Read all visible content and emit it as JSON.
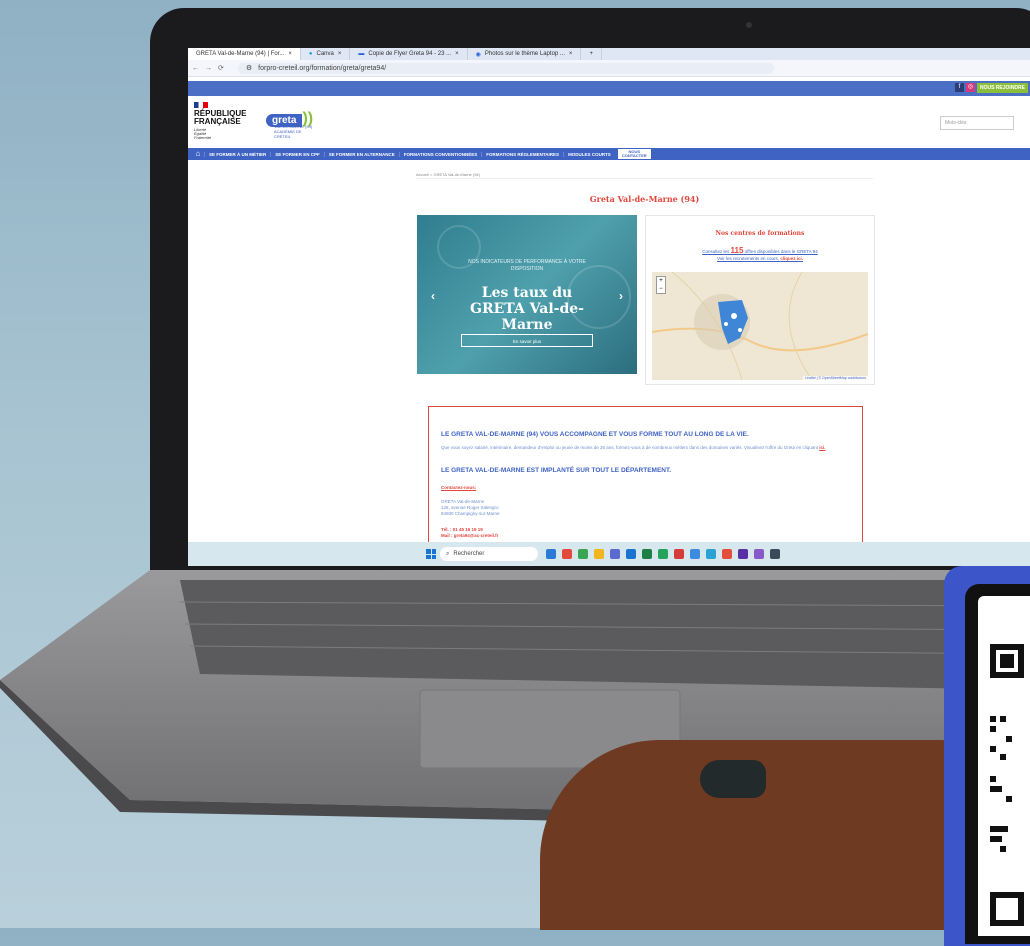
{
  "browser": {
    "tabs": [
      "GRETA Val-de-Marne (94) | For...",
      "Canva",
      "Copie de Flyer Greta 94 - 23 ...",
      "Photos sur le thème Laptop ..."
    ],
    "url": "forpro-creteil.org/formation/greta/greta94/"
  },
  "site": {
    "join_label": "NOUS REJOINDRE",
    "social": [
      "f",
      "◎",
      "in"
    ],
    "republique": "RÉPUBLIQUE\nFRANÇAISE",
    "devise": "Liberté\nÉgalité\nFraternité",
    "logo_text": "greta",
    "logo_sub": "VAL-DE-MARNE (94)\nACADÉMIE DE CRÉTEIL",
    "search_placeholder": "Mots-clés",
    "nav": [
      "SE FORMER À UN MÉTIER",
      "SE FORMER EN CPF",
      "SE FORMER EN ALTERNANCE",
      "FORMATIONS CONVENTIONNÉES",
      "FORMATIONS RÉGLEMENTAIRES",
      "MODULES COURTS"
    ],
    "nav_contact": "NOUS\nCONTACTER",
    "breadcrumb": "Accueil > GRETA Val-de-Marne (94)",
    "page_title": "Greta Val-de-Marne (94)",
    "slider": {
      "kicker": "NOS INDICATEURS DE PERFORMANCE À VOTRE DISPOSITION",
      "headline": "Les taux du GRETA Val-de-Marne",
      "button": "En savoir plus"
    },
    "centres": {
      "title": "Nos centres de formations",
      "line1_prefix": "Consultez les ",
      "count": "115",
      "line1_suffix": " offres disponibles dans le GRETA 94",
      "line2_prefix": "Voir les recrutements en cours, ",
      "line2_link": "cliquez ici.",
      "map_attr": "Leaflet | © OpenStreetMap contributors"
    },
    "info": {
      "h1": "LE GRETA VAL-DE-MARNE (94) VOUS ACCOMPAGNE ET VOUS FORME TOUT AU LONG DE LA VIE.",
      "p": "Que vous soyez salarié, intérimaire, demandeur d'emploi ou jeune de moins de 26 ans, formez-vous à de nombreux métiers dans des domaines variés. Visualisez l'offre du Greta en cliquant ",
      "p_link": "ici.",
      "h2": "LE GRETA VAL-DE-MARNE EST IMPLANTÉ SUR TOUT LE DÉPARTEMENT.",
      "cta": "Contactez-nous:",
      "address": "GRETA Val-de-Marne\n128, avenue Roger Salengro\n94500 Champigny-sur-Marne",
      "tel": "Tél. : 01 45 16 19 19",
      "mail": "Mail : greta94@ac-creteil.fr"
    }
  },
  "taskbar": {
    "search": "Rechercher",
    "app_colors": [
      "#2b7bd6",
      "#e24b3b",
      "#3aa655",
      "#f0b51f",
      "#5b6ad0",
      "#1a73d1",
      "#1e7f45",
      "#25a35a",
      "#d43b3b",
      "#3d8be0",
      "#2aa3d4",
      "#e2503b",
      "#5a2ea6",
      "#8a59c9",
      "#3b4a58"
    ]
  }
}
